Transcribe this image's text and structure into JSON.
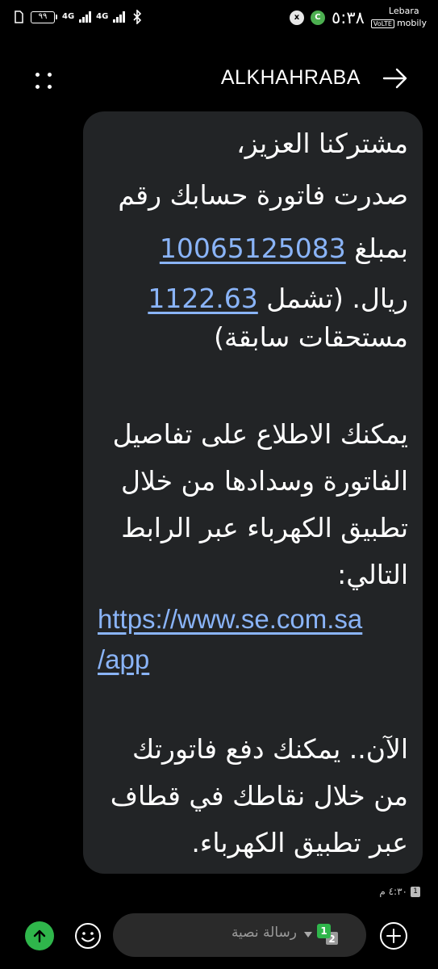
{
  "status_bar": {
    "battery": "٩٩",
    "network_1": "4G",
    "network_2": "4G",
    "x_icon_label": "x",
    "c_icon_label": "C",
    "time": "٥:٣٨",
    "volte": "VoLTE",
    "carrier_1": "Lebara",
    "carrier_2": "mobily"
  },
  "header": {
    "title": "ALKHAHRABA"
  },
  "message": {
    "line_1": "مشتركنا العزيز،",
    "line_2": "صدرت فاتورة حسابك رقم",
    "account_number": "10065125083",
    "line_3_suffix": "بمبلغ",
    "amount": "1122.63",
    "line_4_suffix": "ريال. (تشمل",
    "line_5": "مستحقات سابقة)",
    "line_6": "يمكنك الاطلاع على تفاصيل",
    "line_7": "الفاتورة وسدادها من خلال",
    "line_8": "تطبيق الكهرباء عبر الرابط",
    "line_9": "التالي:",
    "url_part_1": "https://www.se.com.sa",
    "url_part_2": "/app",
    "line_10": "الآن.. يمكنك دفع فاتورتك",
    "line_11": "من خلال نقاطك في قطاف",
    "line_12": "عبر تطبيق الكهرباء."
  },
  "timestamp": {
    "time": "٤:٣٠ م",
    "sim": "1"
  },
  "composer": {
    "placeholder": "رسالة نصية",
    "sim_1": "1",
    "sim_2": "2"
  },
  "colors": {
    "background": "#000000",
    "bubble": "#222426",
    "link": "#8ab4f8",
    "send_green": "#2fb64b"
  }
}
